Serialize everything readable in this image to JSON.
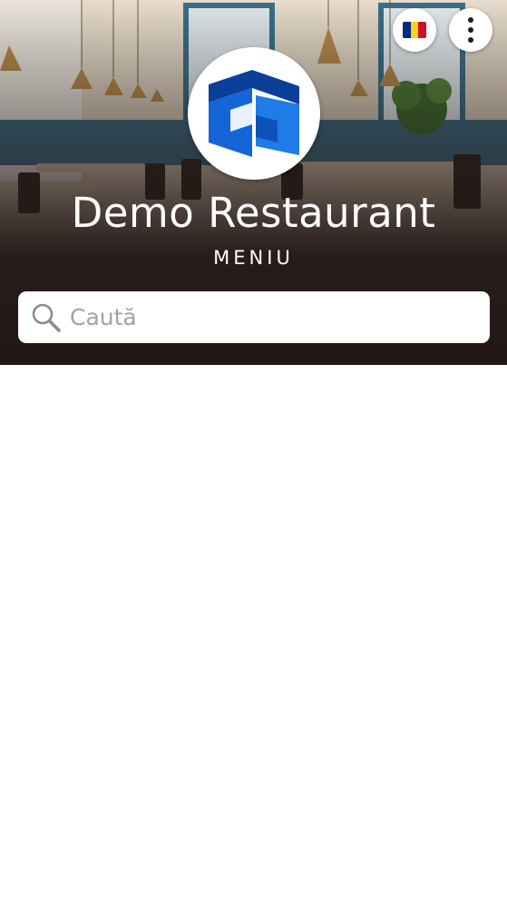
{
  "header": {
    "restaurant_name": "Demo Restaurant",
    "subtitle": "MENIU",
    "language_icon": "romania-flag-icon",
    "more_icon": "more-vertical-icon",
    "logo_icon": "m-logo-icon"
  },
  "search": {
    "placeholder": "Caută",
    "value": ""
  },
  "colors": {
    "hero_dark": "#251a18",
    "logo_blue": "#1565d8",
    "logo_dark_blue": "#0b3f9a",
    "flag_blue": "#002b7f",
    "flag_yellow": "#fcd116",
    "flag_red": "#ce1126"
  }
}
